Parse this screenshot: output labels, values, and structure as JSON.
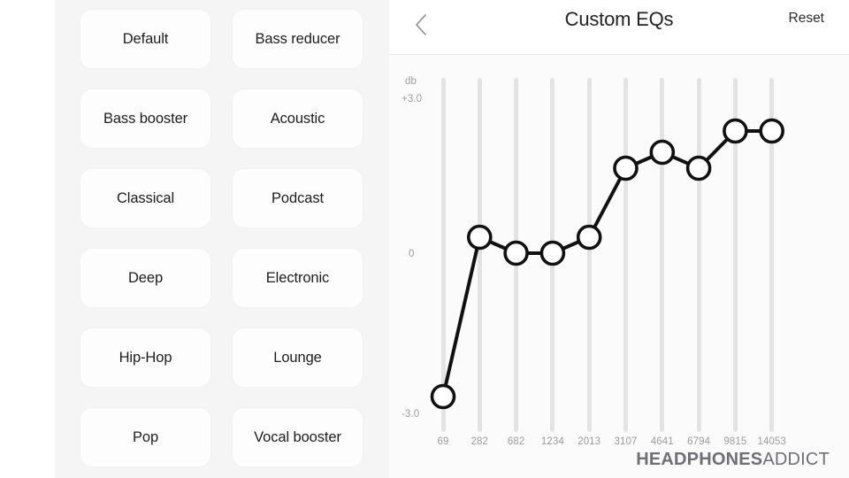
{
  "presets": {
    "items": [
      {
        "label": "Default"
      },
      {
        "label": "Bass reducer"
      },
      {
        "label": "Bass booster"
      },
      {
        "label": "Acoustic"
      },
      {
        "label": "Classical"
      },
      {
        "label": "Podcast"
      },
      {
        "label": "Deep"
      },
      {
        "label": "Electronic"
      },
      {
        "label": "Hip-Hop"
      },
      {
        "label": "Lounge"
      },
      {
        "label": "Pop"
      },
      {
        "label": "Vocal booster"
      }
    ]
  },
  "header": {
    "back_icon": "chevron-left-icon",
    "title": "Custom EQs",
    "reset_label": "Reset"
  },
  "chart_axis": {
    "unit": "db",
    "top": "+3.0",
    "mid": "0",
    "bottom": "-3.0"
  },
  "watermark": {
    "bold": "HEADPHONES",
    "normal": "ADDICT"
  },
  "colors": {
    "panel_bg": "#f5f5f6",
    "button_bg": "#fdfdfd",
    "chart_bg": "#fbfbfb",
    "track": "#e3e3e4",
    "curve": "#111111",
    "text": "#1d1d1f",
    "axis_text": "#9b9ba0"
  },
  "chart_data": {
    "type": "line",
    "title": "Custom EQs",
    "xlabel": "",
    "ylabel": "db",
    "ylim": [
      -3.0,
      3.0
    ],
    "grid": true,
    "legend": "none",
    "categories": [
      "69",
      "282",
      "682",
      "1234",
      "2013",
      "3107",
      "4641",
      "6794",
      "9815",
      "14053"
    ],
    "x": [
      69,
      282,
      682,
      1234,
      2013,
      3107,
      4641,
      6794,
      9815,
      14053
    ],
    "values": [
      -3.0,
      0.0,
      -0.3,
      -0.3,
      0.0,
      1.3,
      1.6,
      1.3,
      2.0,
      2.0
    ],
    "series": [
      {
        "name": "Custom EQ",
        "values": [
          -3.0,
          0.0,
          -0.3,
          -0.3,
          0.0,
          1.3,
          1.6,
          1.3,
          2.0,
          2.0
        ]
      }
    ],
    "yticks": [
      3.0,
      0.0,
      -3.0
    ],
    "yticklabels": [
      "+3.0",
      "0",
      "-3.0"
    ],
    "marker": "circle-open"
  }
}
